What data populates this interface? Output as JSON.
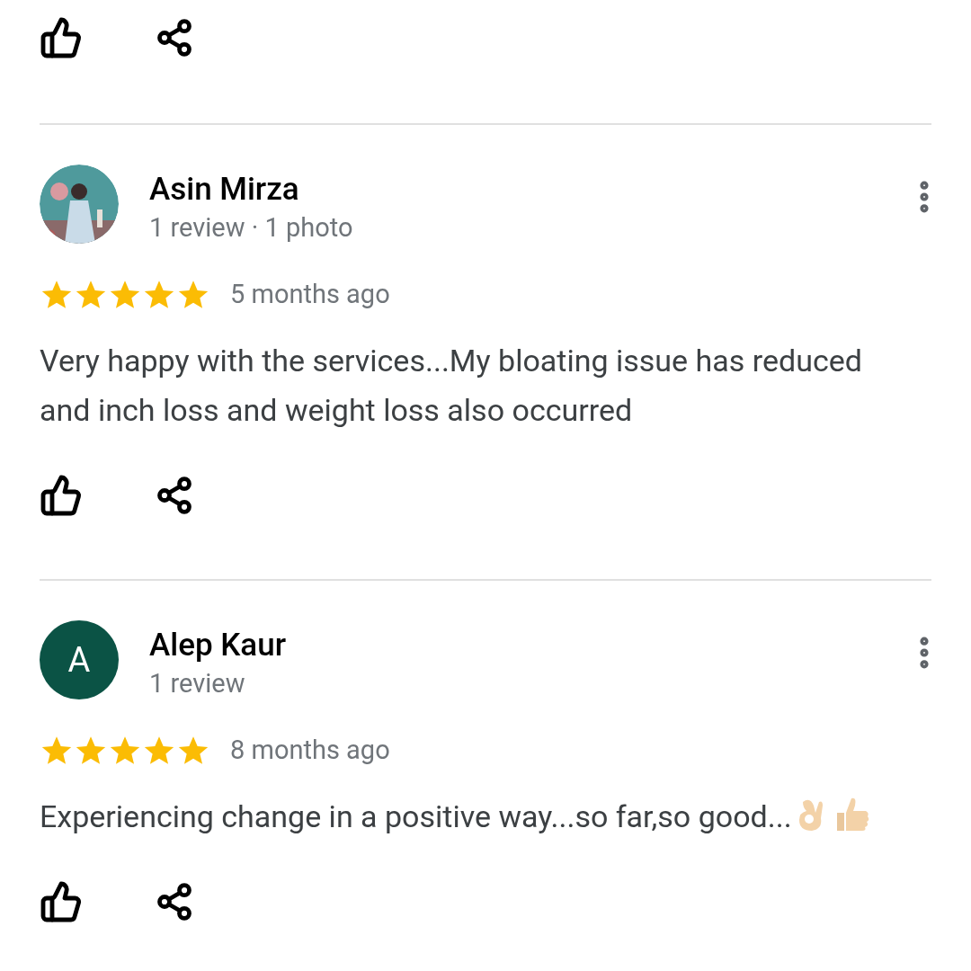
{
  "reviews": [
    {
      "author": "Asin Mirza",
      "stats": "1 review · 1 photo",
      "stars": 5,
      "time": "5 months ago",
      "text": "Very happy with the services...My bloating issue has reduced and inch loss and weight loss also occurred"
    },
    {
      "author": "Alep Kaur",
      "stats": "1 review",
      "avatar": {
        "kind": "letter",
        "letter": "A",
        "color": "#0b5345"
      },
      "stars": 5,
      "time": "8 months ago",
      "text": "Experiencing change in a positive way...so far,so good...",
      "emojis": [
        {
          "kind": "ok_hand"
        },
        {
          "kind": "thumbs_up"
        }
      ]
    }
  ]
}
